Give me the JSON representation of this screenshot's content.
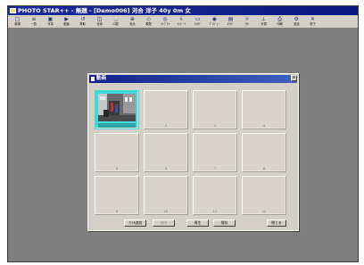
{
  "app": {
    "title": "PHOTO STAR++ - 無題 - [Demo006] 河合 洋子 40y 0m 女"
  },
  "toolbar": {
    "buttons": [
      {
        "label": "新規",
        "icon": "new-file-icon",
        "glyph": "□"
      },
      {
        "label": "一覧",
        "icon": "list-icon",
        "glyph": "≡"
      },
      {
        "label": "写真",
        "icon": "photo-icon",
        "glyph": "▣"
      },
      {
        "label": "動画",
        "icon": "video-icon",
        "glyph": "▶"
      },
      {
        "label": "再取",
        "icon": "recapture-icon",
        "glyph": "↺"
      },
      {
        "label": "全体",
        "icon": "whole-icon",
        "glyph": "◫"
      },
      {
        "label": "口腔",
        "icon": "mouth-icon",
        "glyph": "◡"
      },
      {
        "label": "拡大",
        "icon": "zoom-icon",
        "glyph": "⊕"
      },
      {
        "label": "模型",
        "icon": "model-icon",
        "glyph": "◇"
      },
      {
        "label": "ｷｬﾌﾟﾁｬ",
        "icon": "capture-icon",
        "glyph": "◎"
      },
      {
        "label": "ｲﾝﾎﾟｰﾄ",
        "icon": "import-icon",
        "glyph": "⇩"
      },
      {
        "label": "ﾌｫﾙﾀﾞ",
        "icon": "folder-icon",
        "glyph": "▭"
      },
      {
        "label": "ﾌﾟﾚﾋﾞｭｰ",
        "icon": "preview-icon",
        "glyph": "◉"
      },
      {
        "label": "ｽﾗｲﾄﾞ",
        "icon": "slide-icon",
        "glyph": "▤"
      },
      {
        "label": "ｱｶﾘ",
        "icon": "light-icon",
        "glyph": "☼"
      },
      {
        "label": "計測",
        "icon": "measure-icon",
        "glyph": "⊥"
      },
      {
        "label": "印刷",
        "icon": "print-icon",
        "glyph": "⎙"
      },
      {
        "label": "設定",
        "icon": "settings-icon",
        "glyph": "⚙"
      },
      {
        "label": "終了",
        "icon": "exit-icon",
        "glyph": "✕"
      }
    ]
  },
  "dialog": {
    "title": "動画",
    "close_glyph": "×",
    "cells": [
      {
        "number": "1",
        "caption": "",
        "selected": true
      },
      {
        "number": "2",
        "caption": ""
      },
      {
        "number": "3",
        "caption": ""
      },
      {
        "number": "4",
        "caption": ""
      },
      {
        "number": "5",
        "caption": ""
      },
      {
        "number": "6",
        "caption": ""
      },
      {
        "number": "7",
        "caption": ""
      },
      {
        "number": "8",
        "caption": ""
      },
      {
        "number": "9",
        "caption": ""
      },
      {
        "number": "10",
        "caption": ""
      },
      {
        "number": "11",
        "caption": ""
      },
      {
        "number": "12",
        "caption": ""
      }
    ],
    "buttons": [
      {
        "label": "ﾌｧｲﾙ追加",
        "enabled": true
      },
      {
        "label": "削除",
        "enabled": false
      },
      {
        "label": "再生",
        "enabled": true
      },
      {
        "label": "保存",
        "enabled": true
      },
      {
        "label": "閉じる",
        "enabled": true
      }
    ]
  }
}
